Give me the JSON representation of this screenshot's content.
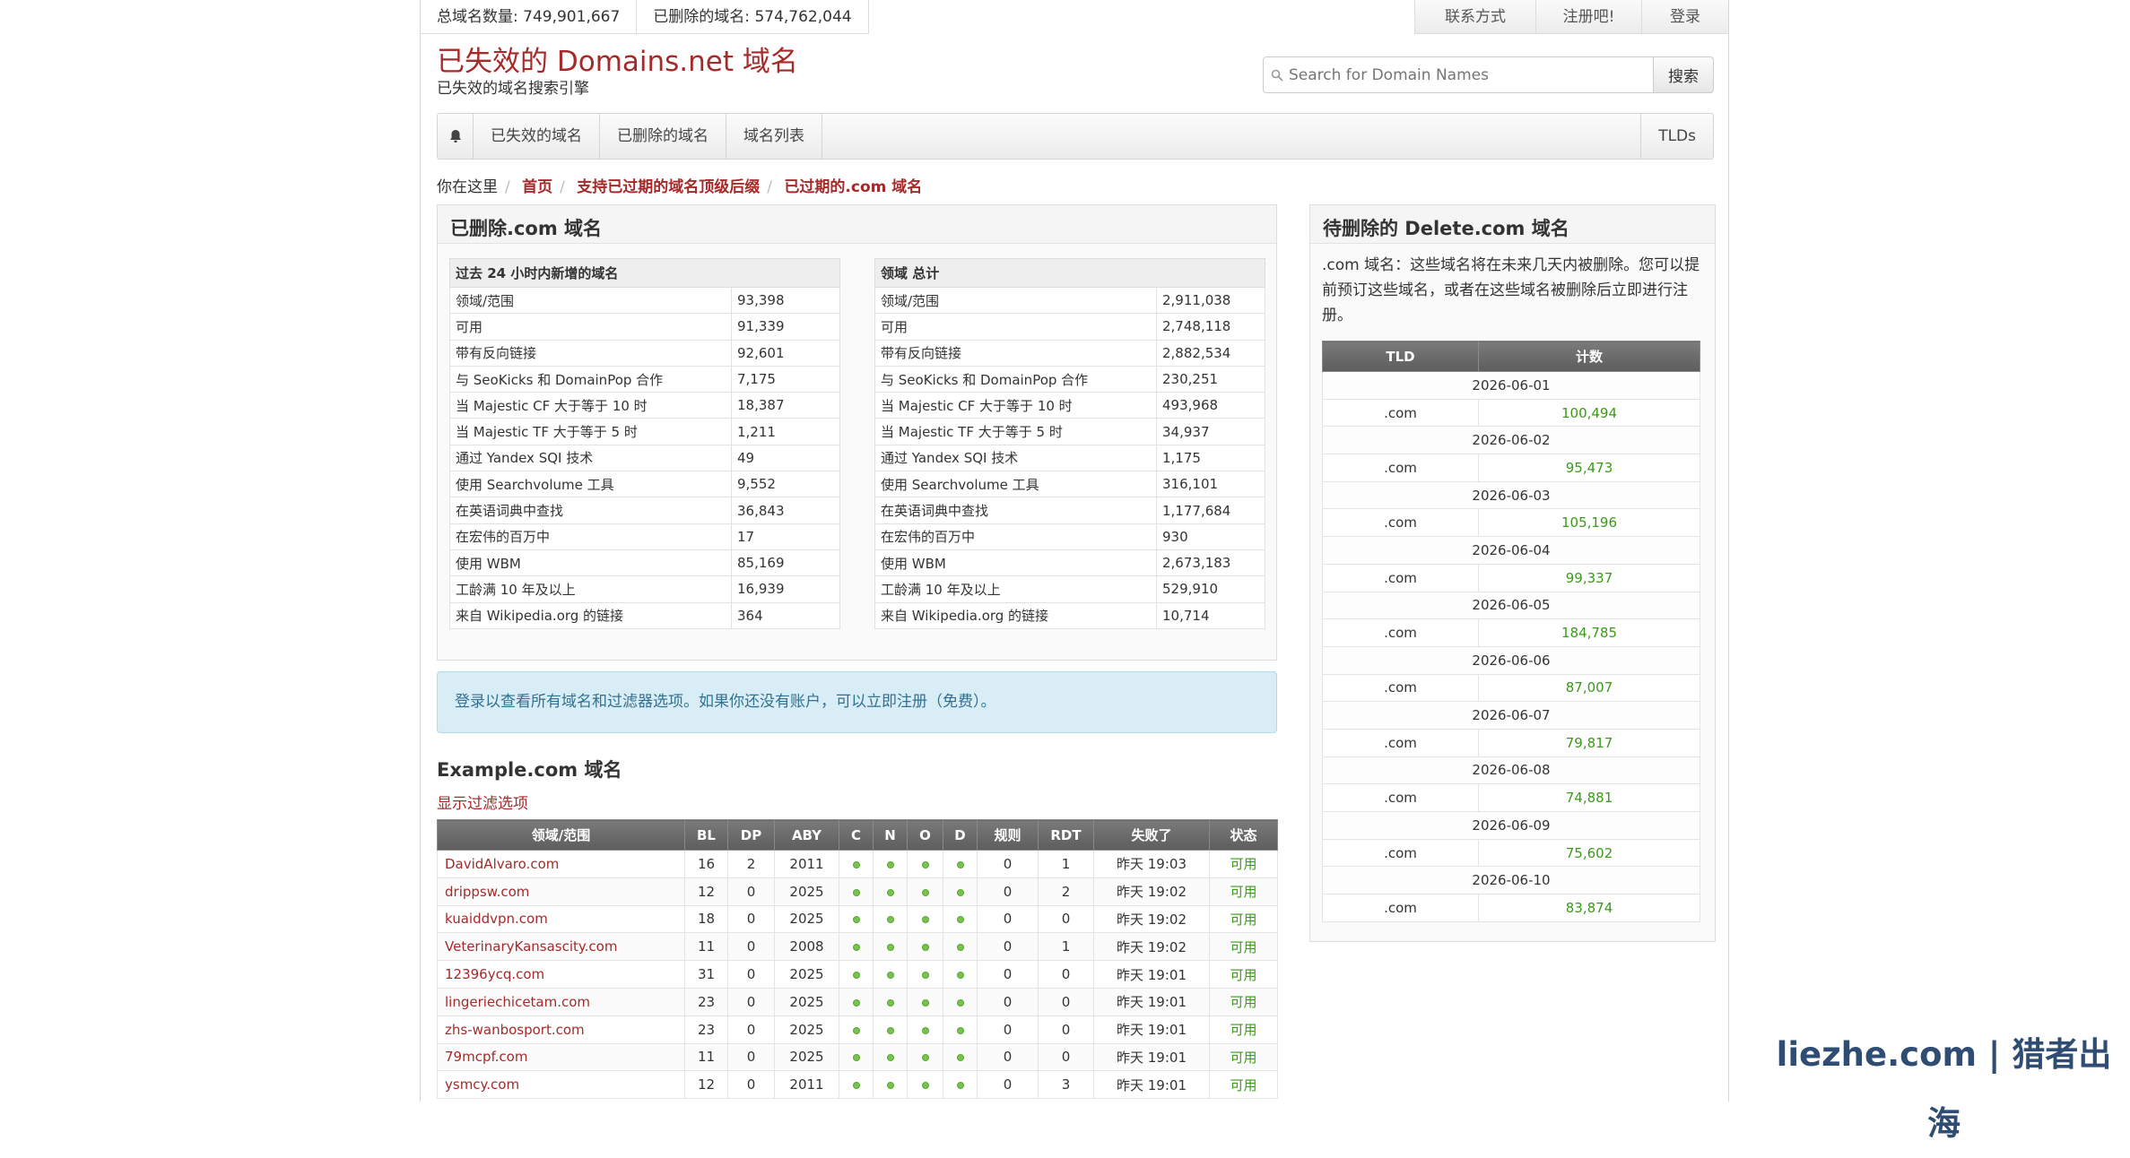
{
  "top_stats": {
    "total_label": "总域名数量:",
    "total_value": "749,901,667",
    "deleted_label": "已删除的域名:",
    "deleted_value": "574,762,044"
  },
  "top_nav": [
    "联系方式",
    "注册吧!",
    "登录"
  ],
  "brand": {
    "title": "已失效的 Domains.net 域名",
    "subtitle": "已失效的域名搜索引擎"
  },
  "search": {
    "placeholder": "Search for Domain Names",
    "button": "搜索"
  },
  "main_nav": {
    "items": [
      "已失效的域名",
      "已删除的域名",
      "域名列表"
    ],
    "right": "TLDs"
  },
  "breadcrumb": {
    "prefix": "你在这里",
    "items": [
      "首页",
      "支持已过期的域名顶级后缀",
      "已过期的.com 域名"
    ]
  },
  "deleted_panel": {
    "title": "已删除.com 域名",
    "left_table": {
      "header": "过去 24 小时内新增的域名",
      "rows": [
        [
          "领域/范围",
          "93,398"
        ],
        [
          "可用",
          "91,339"
        ],
        [
          "带有反向链接",
          "92,601"
        ],
        [
          "与 SeoKicks 和 DomainPop 合作",
          "7,175"
        ],
        [
          "当 Majestic CF 大于等于 10 时",
          "18,387"
        ],
        [
          "当 Majestic TF 大于等于 5 时",
          "1,211"
        ],
        [
          "通过 Yandex SQI 技术",
          "49"
        ],
        [
          "使用 Searchvolume 工具",
          "9,552"
        ],
        [
          "在英语词典中查找",
          "36,843"
        ],
        [
          "在宏伟的百万中",
          "17"
        ],
        [
          "使用 WBM",
          "85,169"
        ],
        [
          "工龄满 10 年及以上",
          "16,939"
        ],
        [
          "来自 Wikipedia.org 的链接",
          "364"
        ]
      ]
    },
    "right_table": {
      "header": "领域 总计",
      "rows": [
        [
          "领域/范围",
          "2,911,038"
        ],
        [
          "可用",
          "2,748,118"
        ],
        [
          "带有反向链接",
          "2,882,534"
        ],
        [
          "与 SeoKicks 和 DomainPop 合作",
          "230,251"
        ],
        [
          "当 Majestic CF 大于等于 10 时",
          "493,968"
        ],
        [
          "当 Majestic TF 大于等于 5 时",
          "34,937"
        ],
        [
          "通过 Yandex SQI 技术",
          "1,175"
        ],
        [
          "使用 Searchvolume 工具",
          "316,101"
        ],
        [
          "在英语词典中查找",
          "1,177,684"
        ],
        [
          "在宏伟的百万中",
          "930"
        ],
        [
          "使用 WBM",
          "2,673,183"
        ],
        [
          "工龄满 10 年及以上",
          "529,910"
        ],
        [
          "来自 Wikipedia.org 的链接",
          "10,714"
        ]
      ]
    }
  },
  "alert": "登录以查看所有域名和过滤器选项。如果你还没有账户，可以立即注册（免费）。",
  "example_section": {
    "title": "Example.com 域名",
    "filter_link": "显示过滤选项",
    "columns": [
      "领域/范围",
      "BL",
      "DP",
      "ABY",
      "C",
      "N",
      "O",
      "D",
      "规则",
      "RDT",
      "失败了",
      "状态"
    ],
    "rows": [
      [
        "DavidAlvaro.com",
        "16",
        "2",
        "2011",
        "0",
        "1",
        "昨天 19:03",
        "可用"
      ],
      [
        "drippsw.com",
        "12",
        "0",
        "2025",
        "0",
        "2",
        "昨天 19:02",
        "可用"
      ],
      [
        "kuaiddvpn.com",
        "18",
        "0",
        "2025",
        "0",
        "0",
        "昨天 19:02",
        "可用"
      ],
      [
        "VeterinaryKansascity.com",
        "11",
        "0",
        "2008",
        "0",
        "1",
        "昨天 19:02",
        "可用"
      ],
      [
        "12396ycq.com",
        "31",
        "0",
        "2025",
        "0",
        "0",
        "昨天 19:01",
        "可用"
      ],
      [
        "lingeriechicetam.com",
        "23",
        "0",
        "2025",
        "0",
        "0",
        "昨天 19:01",
        "可用"
      ],
      [
        "zhs-wanbosport.com",
        "23",
        "0",
        "2025",
        "0",
        "0",
        "昨天 19:01",
        "可用"
      ],
      [
        "79mcpf.com",
        "11",
        "0",
        "2025",
        "0",
        "0",
        "昨天 19:01",
        "可用"
      ],
      [
        "ysmcy.com",
        "12",
        "0",
        "2011",
        "0",
        "3",
        "昨天 19:01",
        "可用"
      ]
    ]
  },
  "pending_panel": {
    "title": "待删除的 Delete.com 域名",
    "description": ".com 域名：这些域名将在未来几天内被删除。您可以提前预订这些域名，或者在这些域名被删除后立即进行注册。",
    "columns": [
      "TLD",
      "计数"
    ],
    "groups": [
      {
        "date": "2026-06-01",
        "tld": ".com",
        "count": "100,494"
      },
      {
        "date": "2026-06-02",
        "tld": ".com",
        "count": "95,473"
      },
      {
        "date": "2026-06-03",
        "tld": ".com",
        "count": "105,196"
      },
      {
        "date": "2026-06-04",
        "tld": ".com",
        "count": "99,337"
      },
      {
        "date": "2026-06-05",
        "tld": ".com",
        "count": "184,785"
      },
      {
        "date": "2026-06-06",
        "tld": ".com",
        "count": "87,007"
      },
      {
        "date": "2026-06-07",
        "tld": ".com",
        "count": "79,817"
      },
      {
        "date": "2026-06-08",
        "tld": ".com",
        "count": "74,881"
      },
      {
        "date": "2026-06-09",
        "tld": ".com",
        "count": "75,602"
      },
      {
        "date": "2026-06-10",
        "tld": ".com",
        "count": "83,874"
      }
    ]
  },
  "watermark": "liezhe.com | 猎者出海",
  "colors": {
    "brand": "#a52a2a",
    "available": "#3a9b16",
    "alert_bg": "#d9edf7",
    "alert_text": "#31708f"
  },
  "icons": {
    "home": "bell-icon",
    "search": "magnifier-icon",
    "status_dot": "green-dot-icon"
  }
}
